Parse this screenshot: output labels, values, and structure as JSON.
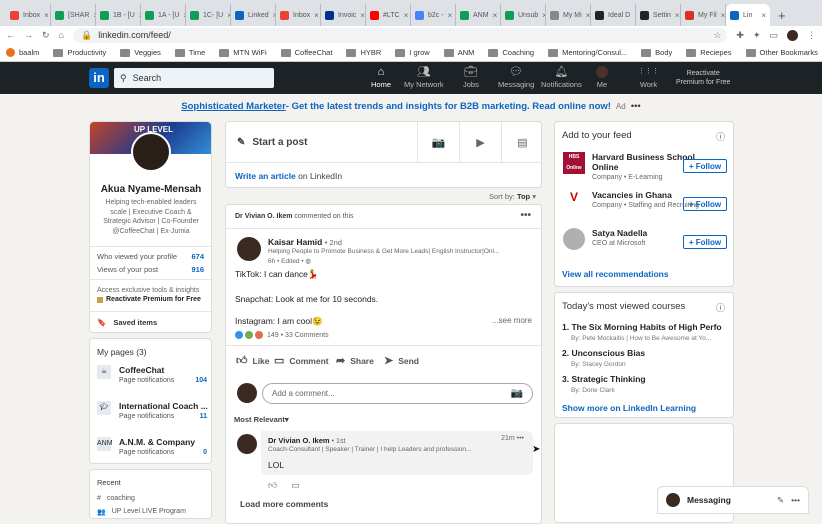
{
  "browser": {
    "tabs": [
      {
        "label": "Inbox",
        "color": "#ea4335"
      },
      {
        "label": "[SHAR",
        "color": "#0f9d58"
      },
      {
        "label": "1B - [U",
        "color": "#0f9d58"
      },
      {
        "label": "1A - [U",
        "color": "#0f9d58"
      },
      {
        "label": "1C- [U",
        "color": "#0f9d58"
      },
      {
        "label": "Linked",
        "color": "#0a66c2"
      },
      {
        "label": "Inbox",
        "color": "#ea4335"
      },
      {
        "label": "Invoic",
        "color": "#003087"
      },
      {
        "label": "#LTC",
        "color": "#ff0000"
      },
      {
        "label": "b2c -",
        "color": "#4285f4"
      },
      {
        "label": "ANM",
        "color": "#0f9d58"
      },
      {
        "label": "Unsub",
        "color": "#0f9d58"
      },
      {
        "label": "My Mi",
        "color": "#888888"
      },
      {
        "label": "Ideal D",
        "color": "#222222"
      },
      {
        "label": "Settin",
        "color": "#222222"
      },
      {
        "label": "My Fil",
        "color": "#d93025"
      },
      {
        "label": "Lin",
        "color": "#0a66c2"
      }
    ],
    "url": "linkedin.com/feed/",
    "bookmarks": [
      "baalm",
      "Productivity",
      "Veggies",
      "Time",
      "MTN WiFi",
      "CoffeeChat",
      "HYBR",
      "I grow",
      "ANM",
      "Coaching",
      "Mentoring/Consul...",
      "Body",
      "Reciepes"
    ],
    "other_bookmarks": "Other Bookmarks"
  },
  "nav": {
    "logo": "in",
    "search_placeholder": "Search",
    "items": [
      {
        "label": "Home",
        "icon": "home-icon"
      },
      {
        "label": "My Network",
        "icon": "network-icon"
      },
      {
        "label": "Jobs",
        "icon": "jobs-icon"
      },
      {
        "label": "Messaging",
        "icon": "messaging-icon"
      },
      {
        "label": "Notifications",
        "icon": "bell-icon"
      },
      {
        "label": "Me",
        "icon": "avatar"
      },
      {
        "label": "Work",
        "icon": "grid-icon"
      }
    ],
    "premium_line1": "Reactivate",
    "premium_line2": "Premium for Free"
  },
  "ad": {
    "link": "Sophisticated Marketer",
    "text": " - Get the latest trends and insights for B2B marketing. Read online now!",
    "label": "Ad"
  },
  "profile": {
    "banner_text": "UP LEVEL",
    "name": "Akua Nyame-Mensah",
    "headline": "Helping tech-enabled leaders scale | Executive Coach & Strategic Advisor | Co-Founder @CoffeeChat | Ex-Jumia",
    "viewed_label": "Who viewed your profile",
    "viewed_count": "674",
    "post_views_label": "Views of your post",
    "post_views_count": "916",
    "premium_text": "Access exclusive tools & insights",
    "premium_link": "Reactivate Premium for Free",
    "saved_items": "Saved items"
  },
  "pages": {
    "title": "My pages (3)",
    "items": [
      {
        "name": "CoffeeChat",
        "sub": "Page notifications",
        "count": "104"
      },
      {
        "name": "International Coach ...",
        "sub": "Page notifications",
        "count": "11"
      },
      {
        "name": "A.N.M. & Company",
        "sub": "Page notifications",
        "count": "0"
      }
    ]
  },
  "recent": {
    "title": "Recent",
    "items": [
      "coaching",
      "UP Level LIVE Program"
    ]
  },
  "share": {
    "start_post": "Start a post",
    "write_article": "Write an article",
    "on_linkedin": " on LinkedIn",
    "sort_label": "Sort by: ",
    "sort_value": "Top"
  },
  "post": {
    "activity_name": "Dr Vivian O. Ikem",
    "activity_text": " commented on this",
    "author": "Kaisar Hamid",
    "degree": "• 2nd",
    "author_headline": "Helping People to Promote Business & Get More Leads| English Instructor|Onl...",
    "time": "6h • Edited •",
    "line1": "TikTok: I can dance💃",
    "line2": "Snapchat: Look at me for 10 seconds.",
    "line3": "Instagram: I am cool😉",
    "see_more": "...see more",
    "reactions": "149 • 33 Comments",
    "actions": [
      "Like",
      "Comment",
      "Share",
      "Send"
    ],
    "comment_placeholder": "Add a comment...",
    "most_relevant": "Most Relevant",
    "comment": {
      "author": "Dr Vivian O. Ikem",
      "degree": "• 1st",
      "headline": "Coach-Consultant | Speaker | Trainer | I help Leaders and profession...",
      "time": "21m",
      "text": "LOL"
    },
    "load_more": "Load more comments"
  },
  "feed": {
    "title": "Add to your feed",
    "items": [
      {
        "name": "Harvard Business School Online",
        "sub": "Company • E-Learning",
        "logo_text": "HBS Online"
      },
      {
        "name": "Vacancies in Ghana",
        "sub": "Company • Staffing and Recruiting",
        "logo_text": "V"
      },
      {
        "name": "Satya Nadella",
        "sub": "CEO at Microsoft",
        "logo_text": ""
      }
    ],
    "follow_label": "+ Follow",
    "view_all": "View all recommendations"
  },
  "courses": {
    "title": "Today's most viewed courses",
    "items": [
      {
        "title": "1. The Six Morning Habits of High Perfor...",
        "by": "By: Pete Mockaitis | How to Be Awesome at Yo..."
      },
      {
        "title": "2. Unconscious Bias",
        "by": "By: Stacey Gordon"
      },
      {
        "title": "3. Strategic Thinking",
        "by": "By: Dorie Clark"
      }
    ],
    "more": "Show more on LinkedIn Learning"
  },
  "messaging": {
    "label": "Messaging"
  }
}
